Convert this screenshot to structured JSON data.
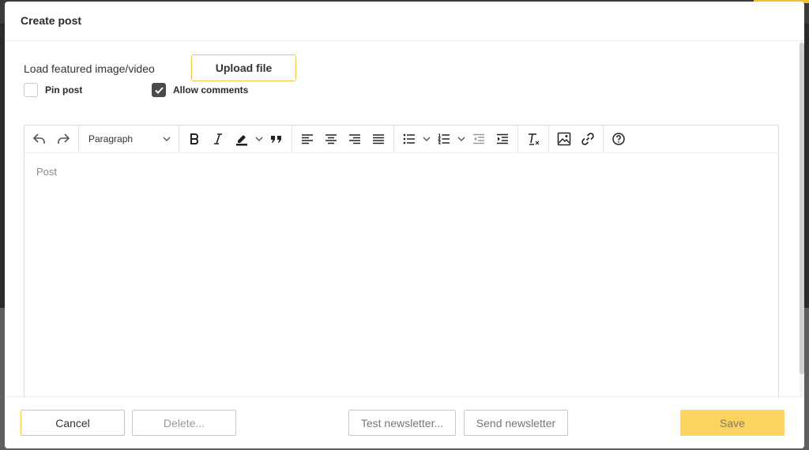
{
  "modal": {
    "title": "Create post"
  },
  "media": {
    "label": "Load featured image/video",
    "upload_label": "Upload file"
  },
  "options": {
    "pin_post": {
      "label": "Pin post",
      "checked": false
    },
    "allow_comments": {
      "label": "Allow comments",
      "checked": true
    }
  },
  "editor": {
    "placeholder": "Post",
    "paragraph_label": "Paragraph",
    "toolbar_icons": [
      "undo-icon",
      "redo-icon",
      "paragraph-select",
      "bold-icon",
      "italic-icon",
      "highlight-icon",
      "blockquote-icon",
      "align-left-icon",
      "align-center-icon",
      "align-right-icon",
      "align-justify-icon",
      "bulleted-list-icon",
      "numbered-list-icon",
      "outdent-icon",
      "indent-icon",
      "remove-format-icon",
      "image-icon",
      "link-icon",
      "help-icon"
    ]
  },
  "footer": {
    "cancel": "Cancel",
    "delete": "Delete...",
    "test_newsletter": "Test newsletter...",
    "send_newsletter": "Send newsletter",
    "save": "Save"
  },
  "colors": {
    "accent": "#f4c542",
    "save_bg": "#fbd35f",
    "checkbox_checked": "#4a4a4a"
  }
}
